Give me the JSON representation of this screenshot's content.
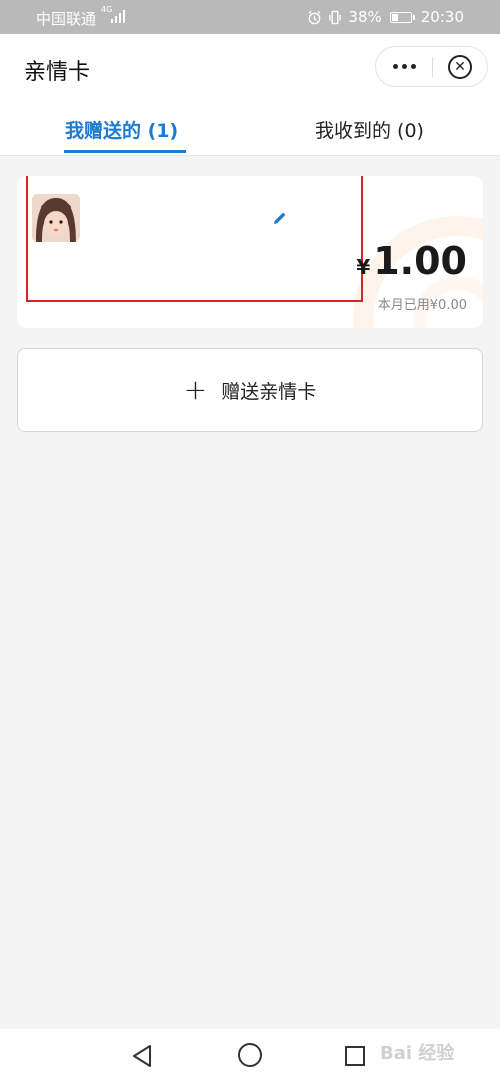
{
  "status_bar": {
    "carrier": "中国联通",
    "network": "4G",
    "battery": "38%",
    "battery_level": 0.38,
    "time": "20:30"
  },
  "header": {
    "title": "亲情卡"
  },
  "tabs": [
    {
      "label": "我赠送的 (1)",
      "active": true
    },
    {
      "label": "我收到的 (0)",
      "active": false
    }
  ],
  "card": {
    "currency": "¥",
    "amount": "1.00",
    "used_text": "本月已用¥0.00",
    "accent": "#1f7ad1",
    "highlight_color": "#d8232a"
  },
  "gift_button": {
    "label": "赠送亲情卡"
  },
  "watermark": "Bai 经验"
}
